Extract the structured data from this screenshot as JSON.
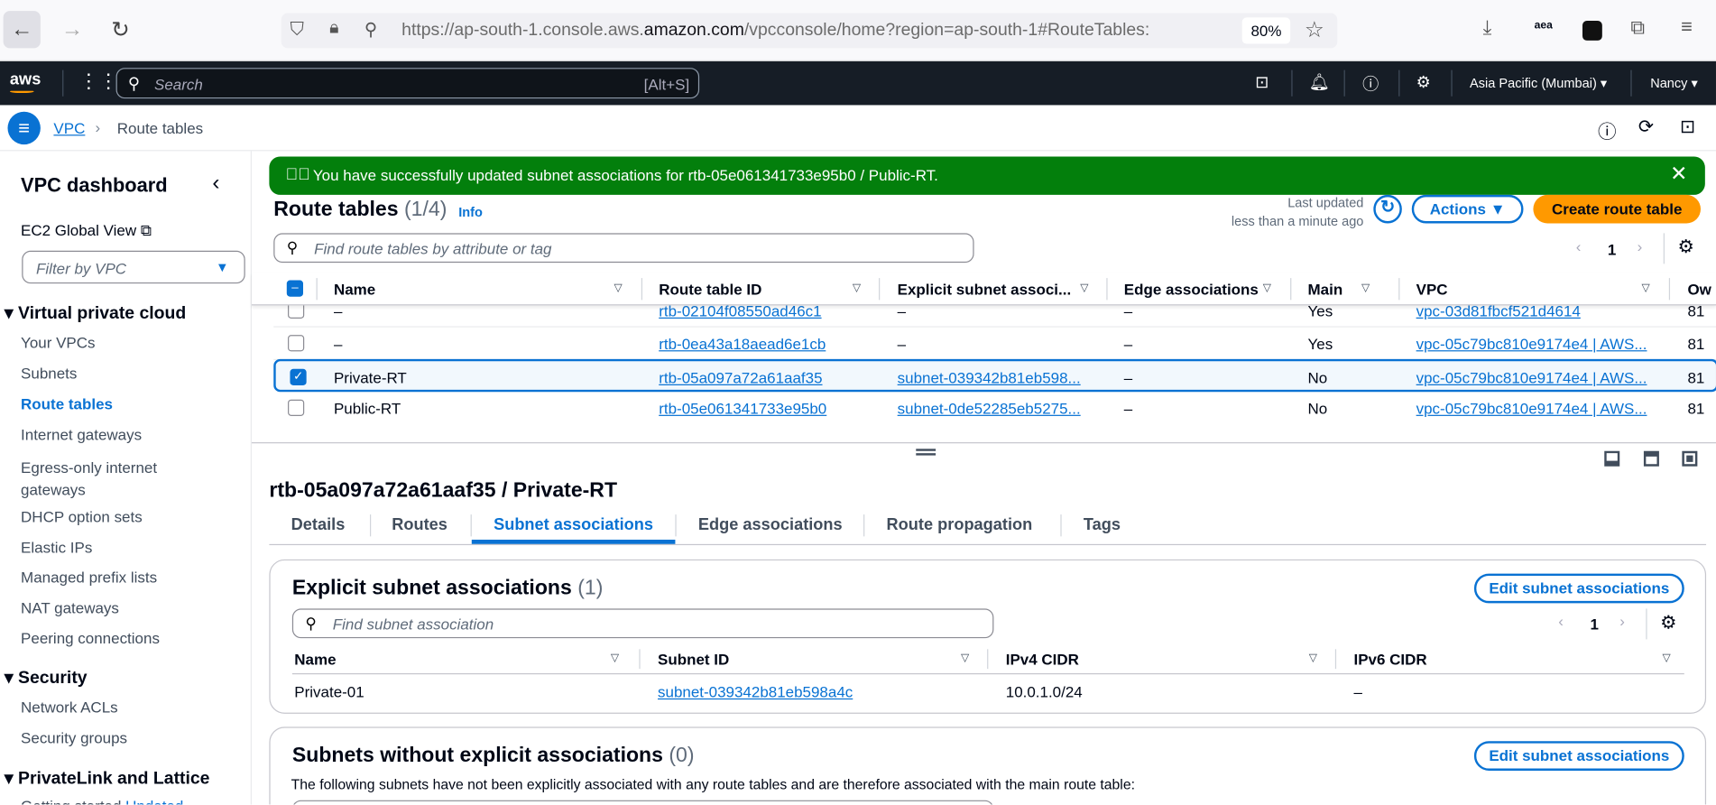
{
  "browser": {
    "url_prefix": "https://ap-south-1.console.aws.",
    "url_domain": "amazon.com",
    "url_suffix": "/vpcconsole/home?region=ap-south-1#RouteTables:",
    "zoom": "80%",
    "ext_label": "aea"
  },
  "awsnav": {
    "logo": "aws",
    "search_placeholder": "Search",
    "shortcut": "[Alt+S]",
    "region": "Asia Pacific (Mumbai)",
    "user": "Nancy"
  },
  "breadcrumb": {
    "root": "VPC",
    "current": "Route tables"
  },
  "sidebar": {
    "title": "VPC dashboard",
    "global": "EC2 Global View",
    "filter": "Filter by VPC",
    "sections": [
      {
        "title": "Virtual private cloud",
        "items": [
          "Your VPCs",
          "Subnets",
          "Route tables",
          "Internet gateways",
          "Egress-only internet gateways",
          "DHCP option sets",
          "Elastic IPs",
          "Managed prefix lists",
          "NAT gateways",
          "Peering connections"
        ]
      },
      {
        "title": "Security",
        "items": [
          "Network ACLs",
          "Security groups"
        ]
      },
      {
        "title": "PrivateLink and Lattice",
        "items": [
          "Getting started"
        ]
      }
    ],
    "updated_badge": "Updated"
  },
  "flash": {
    "message": "You have successfully updated subnet associations for rtb-05e061341733e95b0 / Public-RT."
  },
  "route_tables": {
    "title": "Route tables",
    "count": "(1/4)",
    "info": "Info",
    "last_updated_label": "Last updated",
    "last_updated_value": "less than a minute ago",
    "actions": "Actions",
    "create": "Create route table",
    "search_placeholder": "Find route tables by attribute or tag",
    "page": "1",
    "columns": [
      "Name",
      "Route table ID",
      "Explicit subnet associ...",
      "Edge associations",
      "Main",
      "VPC",
      "Ow"
    ],
    "rows": [
      {
        "name": "–",
        "id": "rtb-02104f08550ad46c1",
        "subnet": "–",
        "edge": "–",
        "main": "Yes",
        "vpc": "vpc-03d81fbcf521d4614",
        "owner": "81",
        "checked": false
      },
      {
        "name": "–",
        "id": "rtb-0ea43a18aead6e1cb",
        "subnet": "–",
        "edge": "–",
        "main": "Yes",
        "vpc": "vpc-05c79bc810e9174e4 | AWS...",
        "owner": "81",
        "checked": false
      },
      {
        "name": "Private-RT",
        "id": "rtb-05a097a72a61aaf35",
        "subnet": "subnet-039342b81eb598...",
        "edge": "–",
        "main": "No",
        "vpc": "vpc-05c79bc810e9174e4 | AWS...",
        "owner": "81",
        "checked": true
      },
      {
        "name": "Public-RT",
        "id": "rtb-05e061341733e95b0",
        "subnet": "subnet-0de52285eb5275...",
        "edge": "–",
        "main": "No",
        "vpc": "vpc-05c79bc810e9174e4 | AWS...",
        "owner": "81",
        "checked": false
      }
    ]
  },
  "detail": {
    "title": "rtb-05a097a72a61aaf35 / Private-RT",
    "tabs": [
      "Details",
      "Routes",
      "Subnet associations",
      "Edge associations",
      "Route propagation",
      "Tags"
    ],
    "active_tab": "Subnet associations",
    "explicit": {
      "title": "Explicit subnet associations",
      "count": "(1)",
      "edit": "Edit subnet associations",
      "search_placeholder": "Find subnet association",
      "page": "1",
      "columns": [
        "Name",
        "Subnet ID",
        "IPv4 CIDR",
        "IPv6 CIDR"
      ],
      "rows": [
        {
          "name": "Private-01",
          "subnet": "subnet-039342b81eb598a4c",
          "ipv4": "10.0.1.0/24",
          "ipv6": "–"
        }
      ]
    },
    "without": {
      "title": "Subnets without explicit associations",
      "count": "(0)",
      "edit": "Edit subnet associations",
      "desc": "The following subnets have not been explicitly associated with any route tables and are therefore associated with the main route table:"
    }
  }
}
